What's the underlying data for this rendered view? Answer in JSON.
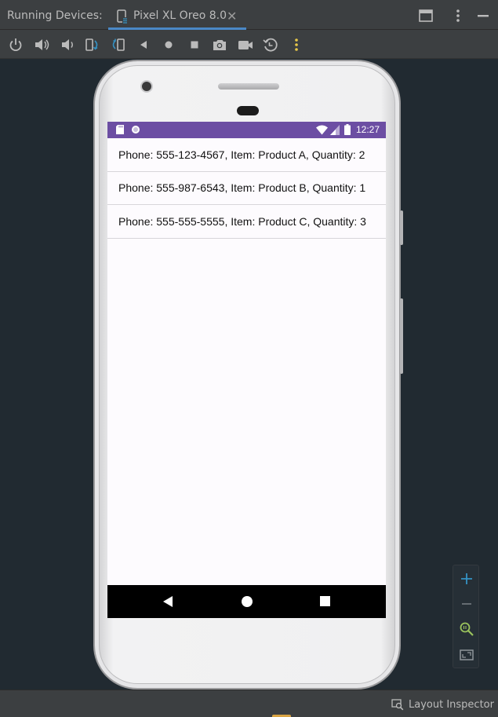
{
  "panel": {
    "title": "Running Devices:",
    "tab_label": "Pixel XL Oreo 8.0",
    "tab_close_icon": "close-icon"
  },
  "toolbar": {
    "icons": [
      "power-icon",
      "volume-up-icon",
      "volume-down-icon",
      "rotate-left-icon",
      "rotate-right-icon",
      "back-icon",
      "home-icon",
      "overview-icon",
      "screenshot-icon",
      "screen-record-icon",
      "snapshot-icon",
      "more-options-icon"
    ]
  },
  "device": {
    "status_time": "12:27",
    "status_color": "#6c4ea3",
    "orders": [
      {
        "text": "Phone: 555-123-4567, Item: Product A, Quantity: 2"
      },
      {
        "text": "Phone: 555-987-6543, Item: Product B, Quantity: 1"
      },
      {
        "text": "Phone: 555-555-5555, Item: Product C, Quantity: 3"
      }
    ]
  },
  "zoom": {
    "icons": [
      "zoom-in-icon",
      "zoom-out-icon",
      "zoom-actual-icon",
      "zoom-fit-icon"
    ]
  },
  "bottom": {
    "layout_inspector_label": "Layout Inspector"
  },
  "colors": {
    "tab_underline": "#4a88c7",
    "toolbar_accent": "#3592c4",
    "more_options": "#e8c84a",
    "zoom_plus": "#3592c4",
    "zoom_search": "#9ac35d"
  }
}
